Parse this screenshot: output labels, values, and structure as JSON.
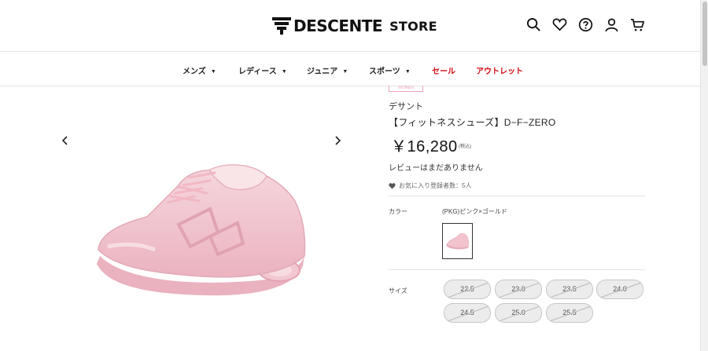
{
  "header": {
    "brand": "DESCENTE",
    "store": "STORE",
    "icons": [
      "search-icon",
      "heart-icon",
      "help-icon",
      "user-icon",
      "cart-icon"
    ]
  },
  "nav": {
    "items": [
      {
        "label": "メンズ",
        "caret": "▼"
      },
      {
        "label": "レディース",
        "caret": "▼"
      },
      {
        "label": "ジュニア",
        "caret": "▼"
      },
      {
        "label": "スポーツ",
        "caret": "▼"
      },
      {
        "label": "セール"
      },
      {
        "label": "アウトレット"
      }
    ]
  },
  "product": {
    "badge": "WOMEN",
    "brand": "デサント",
    "name": "【フィットネスシューズ】D−F−ZERO",
    "price": "￥16,280",
    "tax_note": "(税込)",
    "review": "レビューはまだありません",
    "favorites": "お気に入り登録者数：5人",
    "color_label": "カラー",
    "color_value": "(PKG)ピンク×ゴールド",
    "size_label": "サイズ",
    "sizes": [
      "22.5",
      "23.0",
      "23.5",
      "24.0",
      "24.5",
      "25.0",
      "25.5"
    ]
  },
  "colors": {
    "sale_red": "#d20a11",
    "shoe_pink": "#f2c3cd"
  }
}
